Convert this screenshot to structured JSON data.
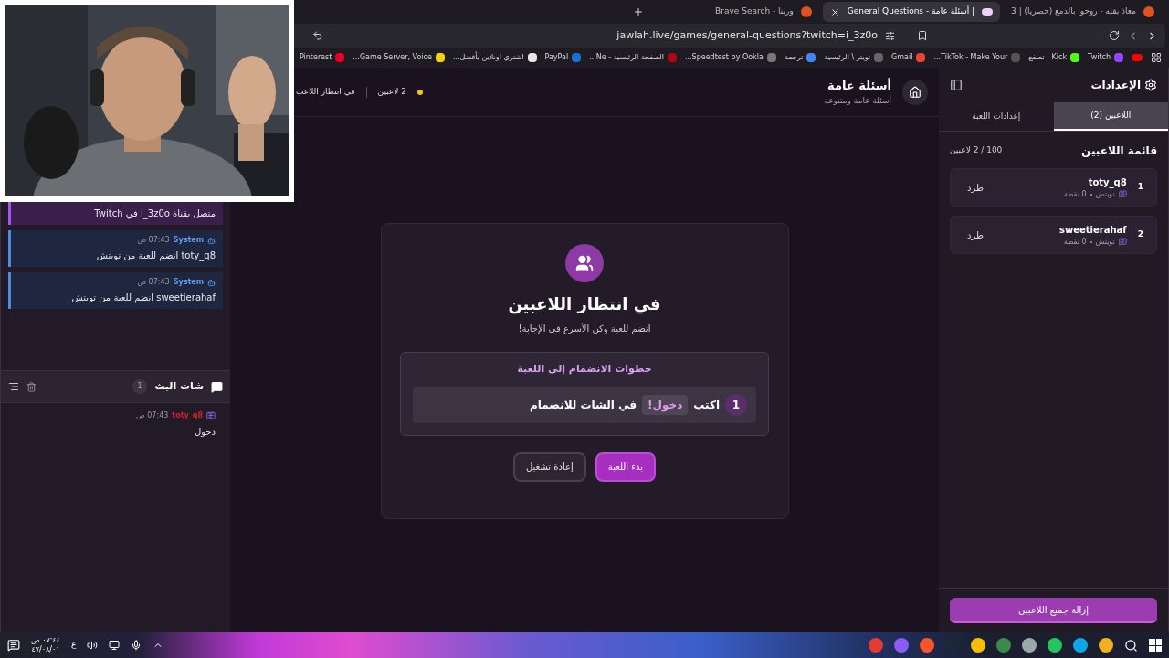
{
  "browser": {
    "tabs": [
      {
        "title": "معاذ بقنه - روحوا بالدمع (حصريا) | 3",
        "selected": false
      },
      {
        "title": "General Questions - أسئلة عامة |",
        "selected": true
      },
      {
        "title": "Brave Search - ورينا",
        "selected": false
      }
    ],
    "url": "jawlah.live/games/general-questions?twitch=i_3z0o",
    "bookmarks": [
      {
        "label": "Twitch",
        "color": "#9146ff"
      },
      {
        "label": "Kick | تصفع",
        "color": "#53fc18"
      },
      {
        "label": "TikTok - Make Your...",
        "color": "#555555"
      },
      {
        "label": "Gmail",
        "color": "#ea4335"
      },
      {
        "label": "تويتر \\ الرئيسية",
        "color": "#666666"
      },
      {
        "label": "ترجمة",
        "color": "#4285f4"
      },
      {
        "label": "Speedtest by Ookla...",
        "color": "#777777"
      },
      {
        "label": "الصفحة الرئيسية - Ne...",
        "color": "#b1060f"
      },
      {
        "label": "PayPal",
        "color": "#1f6fd1"
      },
      {
        "label": "اشتري اونلاين بأفضل...",
        "color": "#e6e6e6"
      },
      {
        "label": "Game Server, Voice...",
        "color": "#f5d20a"
      },
      {
        "label": "Pinterest",
        "color": "#e60023"
      }
    ]
  },
  "chat_log": {
    "messages": [
      {
        "kind": "connection",
        "text": "متصل بقناة i_3z0o في Twitch"
      },
      {
        "kind": "system",
        "sender": "System",
        "time": "07:43 ص",
        "text": "toty_q8 انضم للعبة من تويتش"
      },
      {
        "kind": "system",
        "sender": "System",
        "time": "07:43 ص",
        "text": "sweetierahaf انضم للعبة من تويتش"
      }
    ]
  },
  "stream_chat": {
    "title": "شات البث",
    "count": "1",
    "messages": [
      {
        "user": "toty_q8",
        "time": "07:43 ص",
        "text": "دخول"
      }
    ]
  },
  "game_header": {
    "title": "أسئلة عامة",
    "subtitle": "أسئلة عامة ومتنوعة",
    "players": "2 لاعبين",
    "status": "في انتظار اللاعب"
  },
  "waiting_card": {
    "title": "في انتظار اللاعبين",
    "subtitle": "انضم للعبة وكن الأسرع في الإجابة!",
    "steps_title": "خطوات الانضمام إلى اللعبة",
    "steps": [
      {
        "number": "1",
        "before": "اكتب",
        "command": "!دخول",
        "after": "في الشات للانضمام"
      }
    ],
    "buttons": [
      {
        "label": "بدء اللعبة",
        "kind": "primary"
      },
      {
        "label": "إعادة تشغيل",
        "kind": "secondary"
      }
    ]
  },
  "settings": {
    "title": "الإعدادات",
    "tabs": [
      {
        "label": "اللاعبين (2)",
        "selected": true
      },
      {
        "label": "إعدادات اللعبة",
        "selected": false
      }
    ],
    "list_title": "قائمة اللاعبين",
    "list_count": "100 / 2 لاعبين",
    "players": [
      {
        "rank": "1",
        "name": "toty_q8",
        "platform": "تويتش",
        "points": "0 نقطة",
        "action": "طرد"
      },
      {
        "rank": "2",
        "name": "sweetierahaf",
        "platform": "تويتش",
        "points": "0 نقطة",
        "action": "طرد"
      }
    ],
    "remove_all": "إزالة جميع اللاعبين"
  },
  "taskbar": {
    "time": "٠٧:٤٤ ص",
    "date": "٤٧/٠٨/٠١",
    "language": "ع"
  }
}
